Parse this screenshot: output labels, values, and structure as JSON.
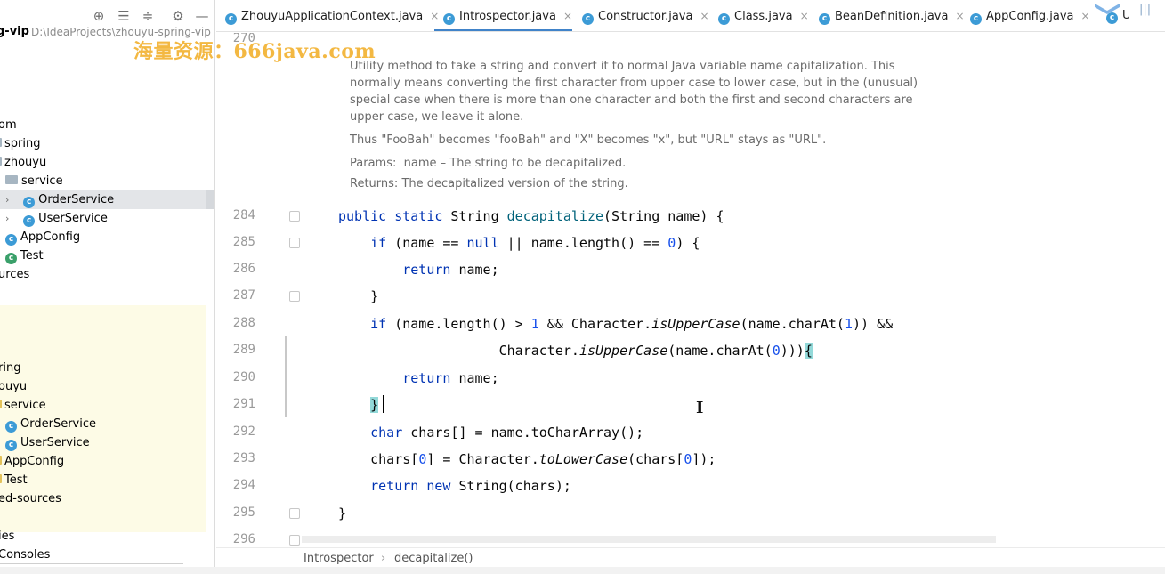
{
  "project": {
    "title": "g-vip",
    "path": "D:\\IdeaProjects\\zhouyu-spring-vip",
    "tree": [
      {
        "label": "om",
        "kind": "text"
      },
      {
        "label": "spring",
        "kind": "text"
      },
      {
        "label": "zhouyu",
        "kind": "text"
      },
      {
        "label": "service",
        "kind": "package"
      },
      {
        "label": "OrderService",
        "kind": "class",
        "expandable": true,
        "selected": true
      },
      {
        "label": "UserService",
        "kind": "class",
        "expandable": true
      },
      {
        "label": "AppConfig",
        "kind": "class"
      },
      {
        "label": "Test",
        "kind": "test"
      },
      {
        "label": "urces",
        "kind": "text"
      }
    ],
    "tree_generated": [
      {
        "label": "ring",
        "kind": "text"
      },
      {
        "label": "ouyu",
        "kind": "text"
      },
      {
        "label": "service",
        "kind": "package-gen"
      },
      {
        "label": "OrderService",
        "kind": "class"
      },
      {
        "label": "UserService",
        "kind": "class"
      },
      {
        "label": "AppConfig",
        "kind": "text"
      },
      {
        "label": "Test",
        "kind": "text"
      },
      {
        "label": "ed-sources",
        "kind": "text"
      }
    ],
    "tree_bottom": [
      {
        "label": "ies"
      },
      {
        "label": "Consoles"
      }
    ]
  },
  "tabs": [
    {
      "label": "ZhouyuApplicationContext.java",
      "active": false
    },
    {
      "label": "Introspector.java",
      "active": true
    },
    {
      "label": "Constructor.java",
      "active": false
    },
    {
      "label": "Class.java",
      "active": false
    },
    {
      "label": "BeanDefinition.java",
      "active": false
    },
    {
      "label": "AppConfig.java",
      "active": false
    },
    {
      "label": "UserServ",
      "active": false
    }
  ],
  "editor": {
    "doc_line_number": "270",
    "doc": {
      "summary": "Utility method to take a string and convert it to normal Java variable name capitalization. This normally means converting the first character from upper case to lower case, but in the (unusual) special case when there is more than one character and both the first and second characters are upper case, we leave it alone.",
      "example": "Thus \"FooBah\" becomes \"fooBah\" and \"X\" becomes \"x\", but \"URL\" stays as \"URL\".",
      "params_label": "Params:",
      "params_text": "name – The string to be decapitalized.",
      "returns_label": "Returns:",
      "returns_text": "The decapitalized version of the string."
    },
    "line_numbers": [
      "284",
      "285",
      "286",
      "287",
      "288",
      "289",
      "290",
      "291",
      "292",
      "293",
      "294",
      "295",
      "296"
    ]
  },
  "breadcrumb": {
    "items": [
      "Introspector",
      "decapitalize()"
    ]
  },
  "watermark": "海量资源：666java.com",
  "colors": {
    "keyword": "#0033b3",
    "number": "#1750eb",
    "method_decl": "#00627a",
    "doc_text": "#6b6b6b",
    "active_tab_underline": "#4083c9",
    "watermark": "#f2b233"
  }
}
